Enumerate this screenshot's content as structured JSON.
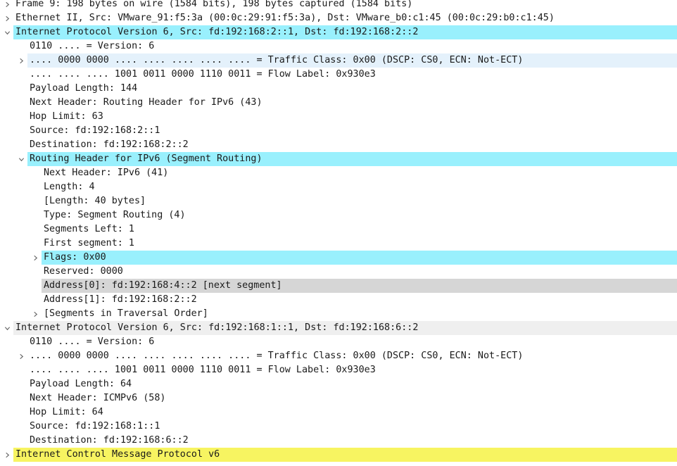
{
  "tree": {
    "rows": [
      {
        "level": 0,
        "toggle": "collapsed",
        "highlight": "",
        "text": "Frame 9: 198 bytes on wire (1584 bits), 198 bytes captured (1584 bits)"
      },
      {
        "level": 0,
        "toggle": "collapsed",
        "highlight": "",
        "text": "Ethernet II, Src: VMware_91:f5:3a (00:0c:29:91:f5:3a), Dst: VMware_b0:c1:45 (00:0c:29:b0:c1:45)"
      },
      {
        "level": 0,
        "toggle": "expanded",
        "highlight": "cyan",
        "text": "Internet Protocol Version 6, Src: fd:192:168:2::1, Dst: fd:192:168:2::2"
      },
      {
        "level": 1,
        "toggle": "none",
        "highlight": "",
        "text": "0110 .... = Version: 6"
      },
      {
        "level": 1,
        "toggle": "collapsed",
        "highlight": "lightblue",
        "text": ".... 0000 0000 .... .... .... .... .... = Traffic Class: 0x00 (DSCP: CS0, ECN: Not-ECT)"
      },
      {
        "level": 1,
        "toggle": "none",
        "highlight": "",
        "text": ".... .... .... 1001 0011 0000 1110 0011 = Flow Label: 0x930e3"
      },
      {
        "level": 1,
        "toggle": "none",
        "highlight": "",
        "text": "Payload Length: 144"
      },
      {
        "level": 1,
        "toggle": "none",
        "highlight": "",
        "text": "Next Header: Routing Header for IPv6 (43)"
      },
      {
        "level": 1,
        "toggle": "none",
        "highlight": "",
        "text": "Hop Limit: 63"
      },
      {
        "level": 1,
        "toggle": "none",
        "highlight": "",
        "text": "Source: fd:192:168:2::1"
      },
      {
        "level": 1,
        "toggle": "none",
        "highlight": "",
        "text": "Destination: fd:192:168:2::2"
      },
      {
        "level": 1,
        "toggle": "expanded",
        "highlight": "cyan",
        "text": "Routing Header for IPv6 (Segment Routing)"
      },
      {
        "level": 2,
        "toggle": "none",
        "highlight": "",
        "text": "Next Header: IPv6 (41)"
      },
      {
        "level": 2,
        "toggle": "none",
        "highlight": "",
        "text": "Length: 4"
      },
      {
        "level": 2,
        "toggle": "none",
        "highlight": "",
        "text": "[Length: 40 bytes]"
      },
      {
        "level": 2,
        "toggle": "none",
        "highlight": "",
        "text": "Type: Segment Routing (4)"
      },
      {
        "level": 2,
        "toggle": "none",
        "highlight": "",
        "text": "Segments Left: 1"
      },
      {
        "level": 2,
        "toggle": "none",
        "highlight": "",
        "text": "First segment: 1"
      },
      {
        "level": 2,
        "toggle": "collapsed",
        "highlight": "cyan",
        "text": "Flags: 0x00"
      },
      {
        "level": 2,
        "toggle": "none",
        "highlight": "",
        "text": "Reserved: 0000"
      },
      {
        "level": 2,
        "toggle": "none",
        "highlight": "gray",
        "text": "Address[0]: fd:192:168:4::2 [next segment]"
      },
      {
        "level": 2,
        "toggle": "none",
        "highlight": "",
        "text": "Address[1]: fd:192:168:2::2"
      },
      {
        "level": 2,
        "toggle": "collapsed",
        "highlight": "",
        "text": "[Segments in Traversal Order]"
      },
      {
        "level": 0,
        "toggle": "expanded",
        "highlight": "lightgray",
        "text": "Internet Protocol Version 6, Src: fd:192:168:1::1, Dst: fd:192:168:6::2"
      },
      {
        "level": 1,
        "toggle": "none",
        "highlight": "",
        "text": "0110 .... = Version: 6"
      },
      {
        "level": 1,
        "toggle": "collapsed",
        "highlight": "",
        "text": ".... 0000 0000 .... .... .... .... .... = Traffic Class: 0x00 (DSCP: CS0, ECN: Not-ECT)"
      },
      {
        "level": 1,
        "toggle": "none",
        "highlight": "",
        "text": ".... .... .... 1001 0011 0000 1110 0011 = Flow Label: 0x930e3"
      },
      {
        "level": 1,
        "toggle": "none",
        "highlight": "",
        "text": "Payload Length: 64"
      },
      {
        "level": 1,
        "toggle": "none",
        "highlight": "",
        "text": "Next Header: ICMPv6 (58)"
      },
      {
        "level": 1,
        "toggle": "none",
        "highlight": "",
        "text": "Hop Limit: 64"
      },
      {
        "level": 1,
        "toggle": "none",
        "highlight": "",
        "text": "Source: fd:192:168:1::1"
      },
      {
        "level": 1,
        "toggle": "none",
        "highlight": "",
        "text": "Destination: fd:192:168:6::2"
      },
      {
        "level": 0,
        "toggle": "collapsed",
        "highlight": "yellow",
        "text": "Internet Control Message Protocol v6"
      }
    ]
  },
  "colors": {
    "cyan": "#99f0fd",
    "lightblue": "#e4f1fb",
    "gray": "#d6d6d6",
    "lightgray": "#efefef",
    "yellow": "#f7f461",
    "text": "#1a1a1a",
    "toggle": "#6b6b6b"
  },
  "icons": {
    "collapsed": "chevron-right-icon",
    "expanded": "chevron-down-icon"
  }
}
